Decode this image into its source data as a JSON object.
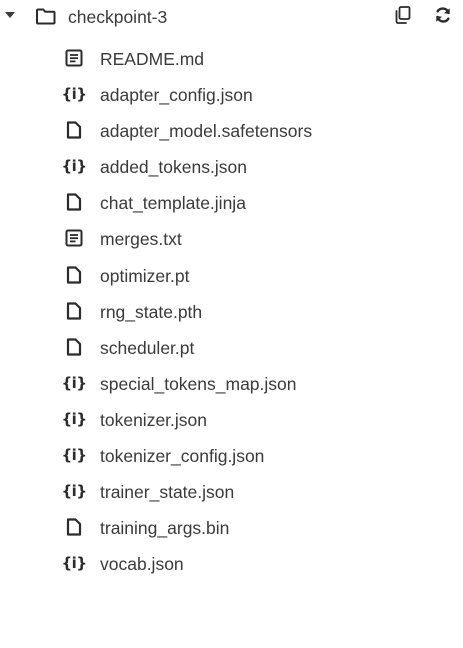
{
  "folder": {
    "name": "checkpoint-3",
    "expanded": true,
    "icon": "folder-icon",
    "actions": [
      {
        "name": "copy-path",
        "icon": "copy-icon"
      },
      {
        "name": "refresh",
        "icon": "refresh-icon"
      }
    ]
  },
  "files": [
    {
      "name": "README.md",
      "icon": "text-file"
    },
    {
      "name": "adapter_config.json",
      "icon": "json-file"
    },
    {
      "name": "adapter_model.safetensors",
      "icon": "blank-file"
    },
    {
      "name": "added_tokens.json",
      "icon": "json-file"
    },
    {
      "name": "chat_template.jinja",
      "icon": "blank-file"
    },
    {
      "name": "merges.txt",
      "icon": "text-file"
    },
    {
      "name": "optimizer.pt",
      "icon": "blank-file"
    },
    {
      "name": "rng_state.pth",
      "icon": "blank-file"
    },
    {
      "name": "scheduler.pt",
      "icon": "blank-file"
    },
    {
      "name": "special_tokens_map.json",
      "icon": "json-file"
    },
    {
      "name": "tokenizer.json",
      "icon": "json-file"
    },
    {
      "name": "tokenizer_config.json",
      "icon": "json-file"
    },
    {
      "name": "trainer_state.json",
      "icon": "json-file"
    },
    {
      "name": "training_args.bin",
      "icon": "blank-file"
    },
    {
      "name": "vocab.json",
      "icon": "json-file"
    }
  ],
  "json_glyph": "{i}",
  "colors": {
    "text": "#3a3a3a",
    "icon": "#2b2b2b",
    "background": "#ffffff"
  }
}
